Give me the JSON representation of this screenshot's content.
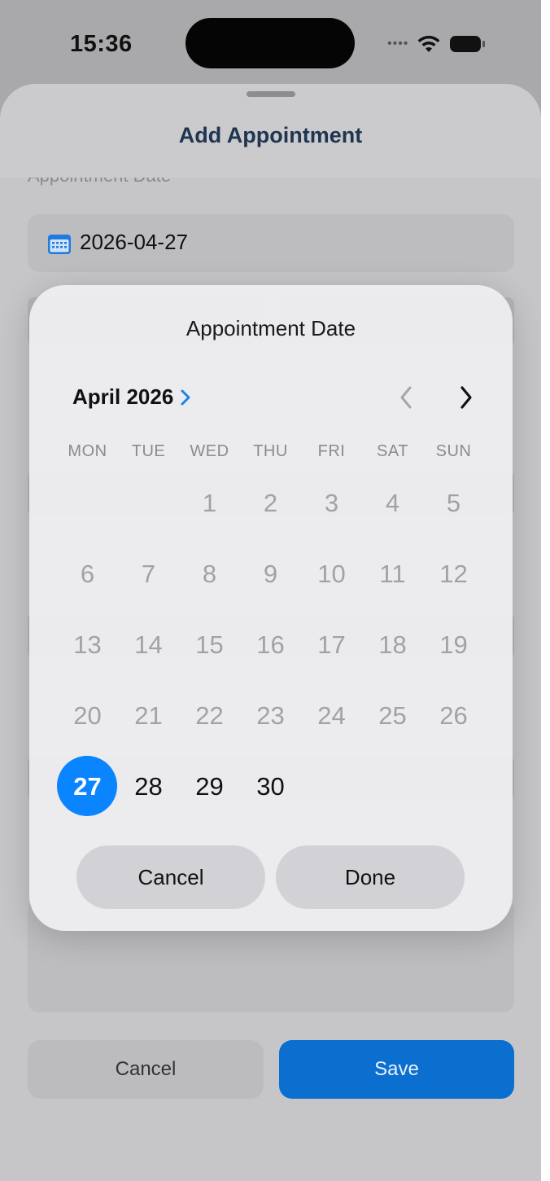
{
  "status_bar": {
    "time": "15:36",
    "icons": [
      "cellular-dots-icon",
      "wifi-icon",
      "battery-icon"
    ]
  },
  "sheet": {
    "title": "Add Appointment",
    "date_label": "Appointment Date",
    "date_value": "2026-04-27",
    "cancel_label": "Cancel",
    "save_label": "Save"
  },
  "date_picker": {
    "title": "Appointment Date",
    "month": "April 2026",
    "weekdays": [
      "MON",
      "TUE",
      "WED",
      "THU",
      "FRI",
      "SAT",
      "SUN"
    ],
    "leading_blanks": 2,
    "days": [
      "1",
      "2",
      "3",
      "4",
      "5",
      "6",
      "7",
      "8",
      "9",
      "10",
      "11",
      "12",
      "13",
      "14",
      "15",
      "16",
      "17",
      "18",
      "19",
      "20",
      "21",
      "22",
      "23",
      "24",
      "25",
      "26",
      "27",
      "28",
      "29",
      "30"
    ],
    "selected_day": "27",
    "enabled_days": [
      "27",
      "28",
      "29",
      "30"
    ],
    "cancel_label": "Cancel",
    "done_label": "Done"
  },
  "colors": {
    "accent": "#0a84ff",
    "save_button": "#0b6fd0",
    "title": "#1f3550"
  }
}
